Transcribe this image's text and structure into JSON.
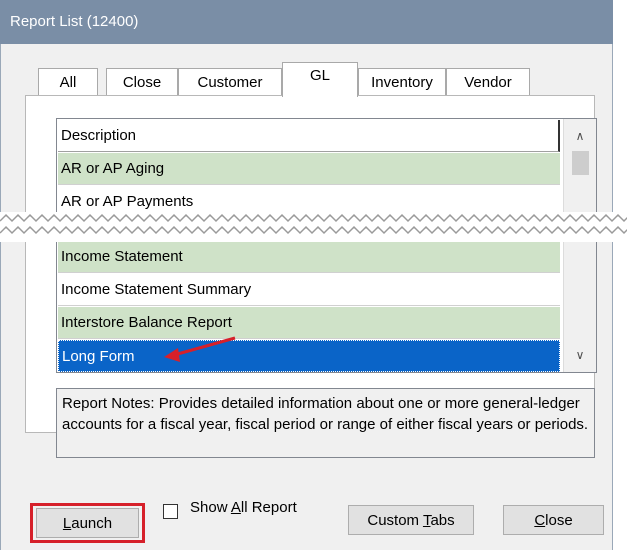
{
  "window": {
    "title": "Report List (12400)"
  },
  "tabs": [
    {
      "label": "All"
    },
    {
      "label": "Close"
    },
    {
      "label": "Customer"
    },
    {
      "label": "GL"
    },
    {
      "label": "Inventory"
    },
    {
      "label": "Vendor"
    }
  ],
  "active_tab": "GL",
  "grid": {
    "header": "Description",
    "rows": [
      {
        "label": "AR or AP Aging"
      },
      {
        "label": "AR or AP Payments"
      },
      {
        "label": "Income Statement"
      },
      {
        "label": "Income Statement Summary"
      },
      {
        "label": "Interstore Balance Report"
      },
      {
        "label": "Long Form"
      }
    ],
    "selected": "Long Form"
  },
  "notes": "Report Notes:  Provides detailed information about one or more general-ledger accounts for a fiscal year, fiscal period or range of either fiscal years or periods.",
  "buttons": {
    "launch": {
      "pre": "",
      "key": "L",
      "post": "aunch"
    },
    "custom_tabs": {
      "pre": "Custom ",
      "key": "T",
      "post": "abs"
    },
    "close": {
      "pre": "",
      "key": "C",
      "post": "lose"
    }
  },
  "show_all": {
    "pre": "Show ",
    "key": "A",
    "post": "ll Report",
    "checked": false
  },
  "colors": {
    "highlight": "#d6202a",
    "selection": "#0a64c8",
    "row_green": "#cfe2c8"
  },
  "icons": {
    "scroll_up": "up-arrow-icon",
    "scroll_down": "down-arrow-icon",
    "callout": "red-arrow-icon"
  }
}
